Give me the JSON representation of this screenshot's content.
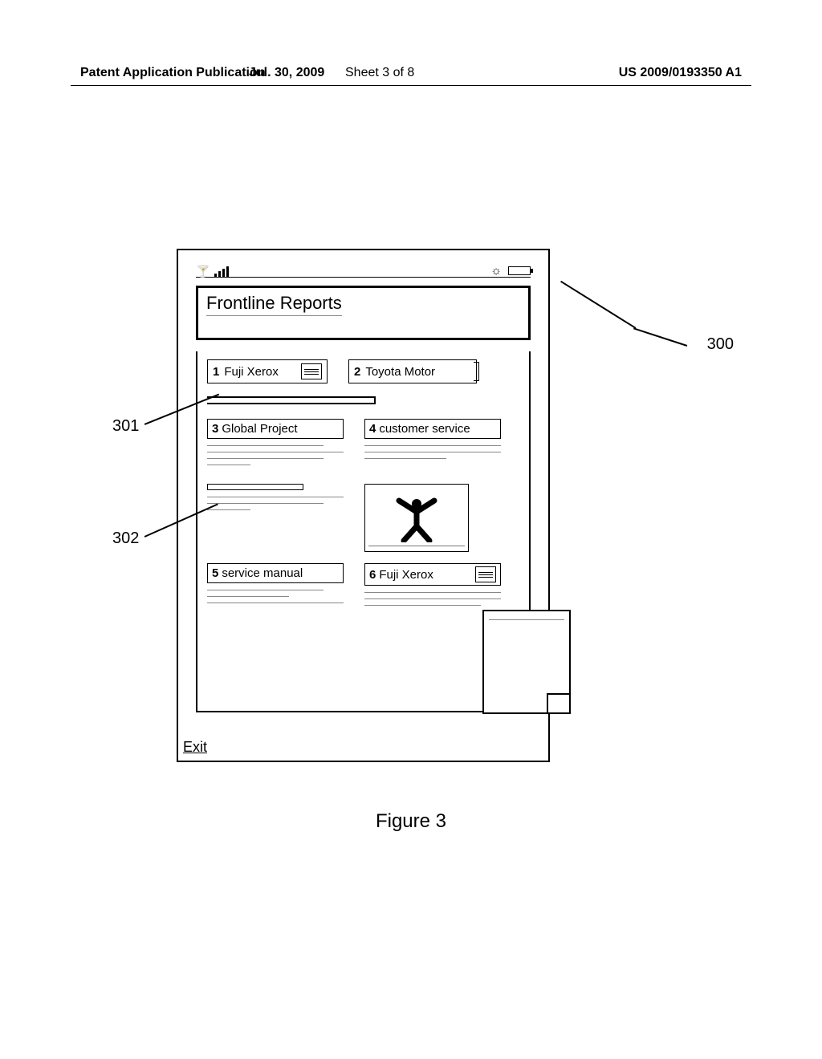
{
  "header": {
    "left": "Patent Application Publication",
    "date": "Jul. 30, 2009",
    "sheet": "Sheet 3 of 8",
    "pubno": "US 2009/0193350 A1"
  },
  "device": {
    "title": "Frontline Reports",
    "cards": {
      "c1": {
        "num": "1",
        "label": "Fuji Xerox"
      },
      "c2": {
        "num": "2",
        "label": "Toyota Motor"
      },
      "c3": {
        "num": "3",
        "label": "Global Project"
      },
      "c4": {
        "num": "4",
        "label": "customer service"
      },
      "c5": {
        "num": "5",
        "label": "service manual"
      },
      "c6": {
        "num": "6",
        "label": "Fuji Xerox"
      }
    },
    "softkey": "Exit"
  },
  "callouts": {
    "c300": "300",
    "c301": "301",
    "c302": "302"
  },
  "figure_label": "Figure 3"
}
